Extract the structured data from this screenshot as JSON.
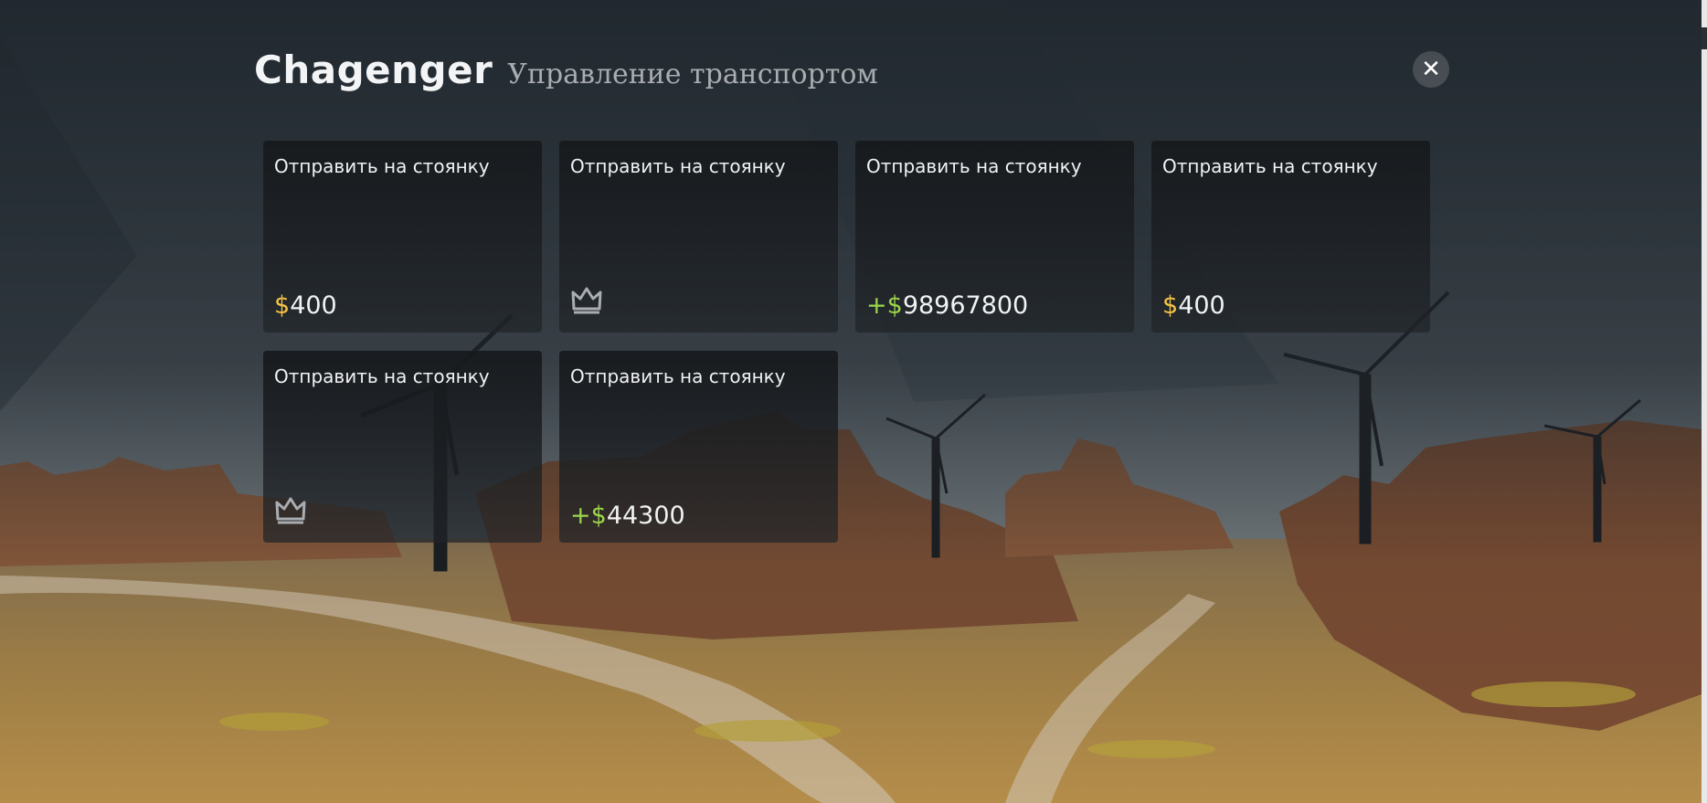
{
  "header": {
    "title": "Chagenger",
    "subtitle": "Управление транспортом"
  },
  "close_icon": "close-icon",
  "colors": {
    "currency_gold": "#f5c445",
    "currency_green": "#9cd64a",
    "text": "#f1f2f3",
    "subtitle": "#a9adb1"
  },
  "cards": [
    {
      "label": "Отправить на стоянку",
      "kind": "price",
      "prefix": "",
      "currency": "$",
      "amount": "400",
      "currency_color": "gold"
    },
    {
      "label": "Отправить на стоянку",
      "kind": "crown",
      "icon": "crown-icon"
    },
    {
      "label": "Отправить на стоянку",
      "kind": "price",
      "prefix": "+",
      "currency": "$",
      "amount": "98967800",
      "currency_color": "green"
    },
    {
      "label": "Отправить на стоянку",
      "kind": "price",
      "prefix": "",
      "currency": "$",
      "amount": "400",
      "currency_color": "gold"
    },
    {
      "label": "Отправить на стоянку",
      "kind": "crown",
      "icon": "crown-icon"
    },
    {
      "label": "Отправить на стоянку",
      "kind": "price",
      "prefix": "+",
      "currency": "$",
      "amount": "44300",
      "currency_color": "green"
    }
  ]
}
